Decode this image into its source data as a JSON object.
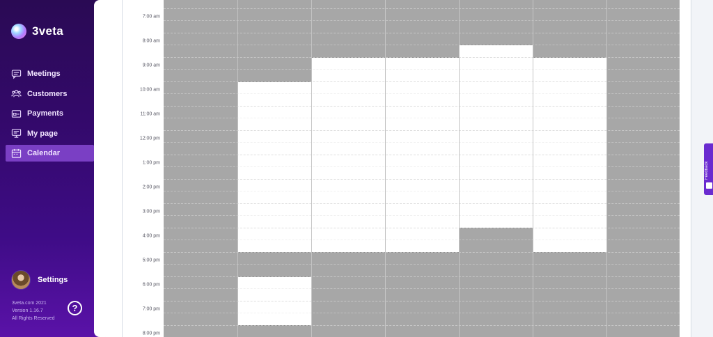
{
  "app": {
    "logo_text": "3veta"
  },
  "sidebar": {
    "items": [
      {
        "label": "Meetings",
        "icon": "chat-icon",
        "active": false
      },
      {
        "label": "Customers",
        "icon": "users-icon",
        "active": false
      },
      {
        "label": "Payments",
        "icon": "card-icon",
        "active": false
      },
      {
        "label": "My page",
        "icon": "monitor-icon",
        "active": false
      },
      {
        "label": "Calendar",
        "icon": "calendar-icon",
        "active": true
      }
    ],
    "settings_label": "Settings",
    "footer": {
      "line1": "3veta.com 2021",
      "line2": "Version 1.16.7",
      "line3": "All Rights Reserved"
    },
    "help_label": "?"
  },
  "calendar": {
    "time_labels": [
      "7:00 am",
      "8:00 am",
      "9:00 am",
      "10:00 am",
      "11:00 am",
      "12:00 pm",
      "1:00 pm",
      "2:00 pm",
      "3:00 pm",
      "4:00 pm",
      "5:00 pm",
      "6:00 pm",
      "7:00 pm",
      "8:00 pm"
    ],
    "first_visible_hour": 6.66,
    "days": [
      {
        "available": []
      },
      {
        "available": [
          [
            10,
            17
          ],
          [
            18,
            20
          ]
        ]
      },
      {
        "available": [
          [
            9,
            17
          ]
        ]
      },
      {
        "available": [
          [
            9,
            17
          ]
        ]
      },
      {
        "available": [
          [
            8.5,
            16
          ]
        ]
      },
      {
        "available": [
          [
            9,
            17
          ]
        ]
      },
      {
        "available": []
      }
    ]
  },
  "feedback": {
    "label": "Feedback"
  },
  "colors": {
    "unavailable": "#a7a7a7",
    "available": "#ffffff",
    "sidebar_active": "#7a3fc4",
    "accent": "#6a2bd0"
  }
}
